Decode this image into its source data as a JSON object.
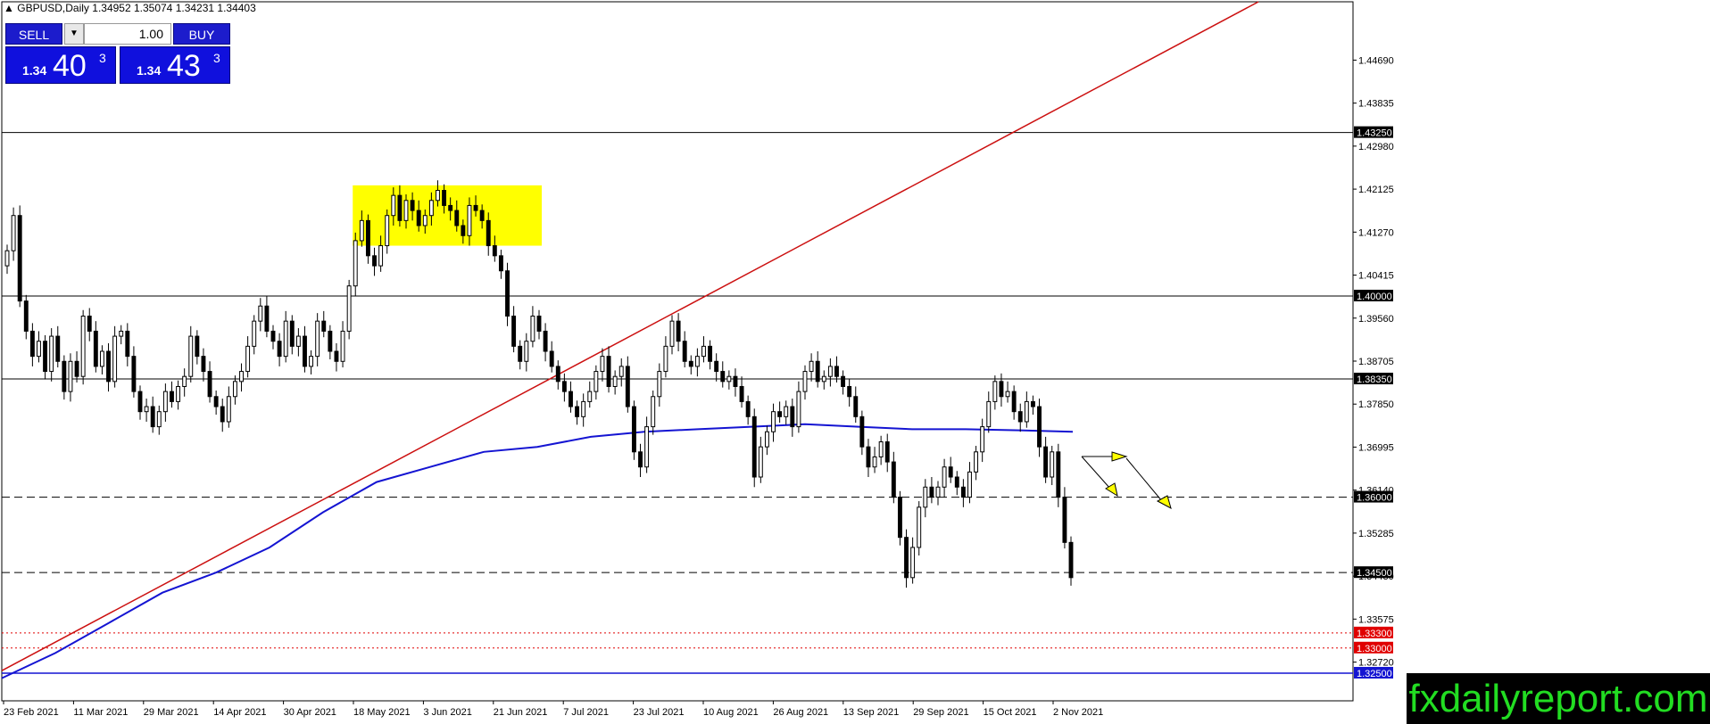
{
  "header": {
    "symbol": "GBPUSD,Daily",
    "ohlc": "1.34952 1.35074 1.34231 1.34403"
  },
  "trade_panel": {
    "sell_label": "SELL",
    "buy_label": "BUY",
    "lot": "1.00",
    "sell_price_prefix": "1.34",
    "sell_price_big": "40",
    "sell_price_sup": "3",
    "buy_price_prefix": "1.34",
    "buy_price_big": "43",
    "buy_price_sup": "3"
  },
  "logo_text": "fxdailyreport.com",
  "colors": {
    "background": "#ffffff",
    "candle": "#000000",
    "ma": "#1414d2",
    "trendline": "#cc1010",
    "highlight": "#ffff00",
    "level_red": "#e00000",
    "level_blue": "#1414d2",
    "arrow": "#ffff00"
  },
  "chart_data": {
    "type": "candlestick",
    "y_ticks": [
      "1.44690",
      "1.43835",
      "1.42980",
      "1.42125",
      "1.41270",
      "1.40415",
      "1.39560",
      "1.38705",
      "1.37850",
      "1.36995",
      "1.36140",
      "1.35285",
      "1.34430",
      "1.33575",
      "1.32720"
    ],
    "x_ticks": [
      "23 Feb 2021",
      "11 Mar 2021",
      "29 Mar 2021",
      "14 Apr 2021",
      "30 Apr 2021",
      "18 May 2021",
      "3 Jun 2021",
      "21 Jun 2021",
      "7 Jul 2021",
      "23 Jul 2021",
      "10 Aug 2021",
      "26 Aug 2021",
      "13 Sep 2021",
      "29 Sep 2021",
      "15 Oct 2021",
      "2 Nov 2021"
    ],
    "ylim": [
      1.3195,
      1.4585
    ],
    "levels": [
      {
        "value": 1.4325,
        "label": "1.43250",
        "style": "solid",
        "color": "#000000"
      },
      {
        "value": 1.4,
        "label": "1.40000",
        "style": "solid",
        "color": "#000000"
      },
      {
        "value": 1.3835,
        "label": "1.38350",
        "style": "solid",
        "color": "#000000"
      },
      {
        "value": 1.36,
        "label": "1.36000",
        "style": "dashed",
        "color": "#000000"
      },
      {
        "value": 1.345,
        "label": "1.34500",
        "style": "dashed",
        "color": "#000000"
      },
      {
        "value": 1.333,
        "label": "1.33300",
        "style": "dotted",
        "color": "#e00000"
      },
      {
        "value": 1.33,
        "label": "1.33000",
        "style": "dotted",
        "color": "#e00000"
      },
      {
        "value": 1.325,
        "label": "1.32500",
        "style": "solid",
        "color": "#1414d2"
      }
    ],
    "candles_closes": [
      1.409,
      1.416,
      1.399,
      1.393,
      1.388,
      1.391,
      1.385,
      1.392,
      1.387,
      1.381,
      1.387,
      1.384,
      1.396,
      1.393,
      1.386,
      1.389,
      1.383,
      1.392,
      1.393,
      1.388,
      1.381,
      1.377,
      1.378,
      1.374,
      1.377,
      1.381,
      1.379,
      1.382,
      1.384,
      1.392,
      1.388,
      1.385,
      1.38,
      1.378,
      1.375,
      1.38,
      1.383,
      1.385,
      1.39,
      1.395,
      1.398,
      1.393,
      1.391,
      1.388,
      1.395,
      1.39,
      1.392,
      1.386,
      1.388,
      1.395,
      1.393,
      1.389,
      1.387,
      1.393,
      1.402,
      1.411,
      1.415,
      1.408,
      1.406,
      1.41,
      1.416,
      1.42,
      1.415,
      1.419,
      1.417,
      1.414,
      1.416,
      1.419,
      1.421,
      1.418,
      1.417,
      1.414,
      1.412,
      1.418,
      1.417,
      1.415,
      1.41,
      1.408,
      1.405,
      1.396,
      1.39,
      1.387,
      1.391,
      1.396,
      1.393,
      1.389,
      1.386,
      1.383,
      1.381,
      1.378,
      1.376,
      1.379,
      1.381,
      1.385,
      1.388,
      1.382,
      1.384,
      1.386,
      1.378,
      1.369,
      1.366,
      1.374,
      1.38,
      1.385,
      1.39,
      1.395,
      1.391,
      1.387,
      1.386,
      1.388,
      1.39,
      1.387,
      1.385,
      1.383,
      1.384,
      1.382,
      1.379,
      1.376,
      1.364,
      1.37,
      1.373,
      1.377,
      1.376,
      1.378,
      1.374,
      1.381,
      1.385,
      1.387,
      1.383,
      1.384,
      1.386,
      1.384,
      1.382,
      1.38,
      1.376,
      1.37,
      1.366,
      1.368,
      1.371,
      1.367,
      1.36,
      1.352,
      1.344,
      1.35,
      1.358,
      1.362,
      1.36,
      1.362,
      1.366,
      1.364,
      1.362,
      1.36,
      1.365,
      1.369,
      1.374,
      1.379,
      1.383,
      1.38,
      1.381,
      1.377,
      1.375,
      1.379,
      1.378,
      1.37,
      1.364,
      1.369,
      1.36,
      1.351,
      1.344
    ],
    "ma_points": [
      [
        0,
        1.324
      ],
      [
        0.05,
        1.329
      ],
      [
        0.1,
        1.335
      ],
      [
        0.15,
        1.341
      ],
      [
        0.2,
        1.345
      ],
      [
        0.25,
        1.35
      ],
      [
        0.3,
        1.357
      ],
      [
        0.35,
        1.363
      ],
      [
        0.4,
        1.366
      ],
      [
        0.45,
        1.369
      ],
      [
        0.5,
        1.37
      ],
      [
        0.55,
        1.372
      ],
      [
        0.6,
        1.373
      ],
      [
        0.65,
        1.3735
      ],
      [
        0.7,
        1.374
      ],
      [
        0.75,
        1.3745
      ],
      [
        0.8,
        1.374
      ],
      [
        0.85,
        1.3735
      ],
      [
        0.9,
        1.3735
      ],
      [
        0.95,
        1.3733
      ],
      [
        1.0,
        1.373
      ]
    ],
    "trendline": {
      "start_value": 1.3255,
      "end_value": 1.4585
    },
    "highlight_box": {
      "top_value": 1.422,
      "bottom_value": 1.41
    }
  }
}
